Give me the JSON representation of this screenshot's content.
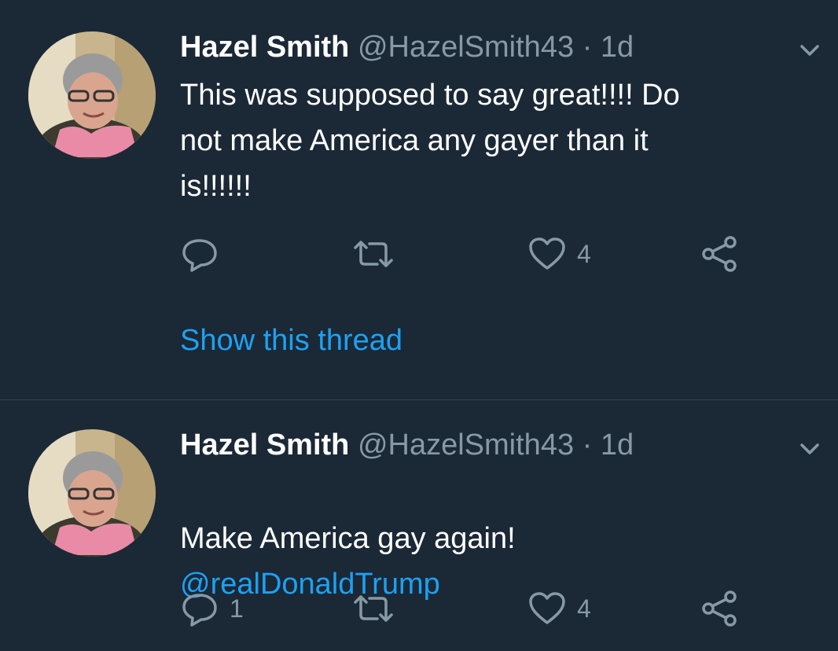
{
  "tweets": [
    {
      "author_name": "Hazel Smith",
      "author_handle": "@HazelSmith43",
      "separator": "·",
      "timestamp": "1d",
      "text": "This was supposed to say great!!!! Do\nnot make America any gayer than it\nis!!!!!!",
      "mention": "",
      "reply_count": "",
      "retweet_count": "",
      "like_count": "4",
      "show_thread_label": "Show this thread"
    },
    {
      "author_name": "Hazel Smith",
      "author_handle": "@HazelSmith43",
      "separator": "·",
      "timestamp": "1d",
      "text": "Make America gay again!",
      "mention": "@realDonaldTrump",
      "reply_count": "1",
      "retweet_count": "",
      "like_count": "4"
    }
  ],
  "icons": {
    "reply": "reply-icon",
    "retweet": "retweet-icon",
    "like": "heart-icon",
    "share": "share-icon",
    "menu": "chevron-down-icon"
  },
  "colors": {
    "background": "#1b2836",
    "text_primary": "#ffffff",
    "text_secondary": "#8899a6",
    "accent": "#1da1f2",
    "divider": "#38444d"
  }
}
